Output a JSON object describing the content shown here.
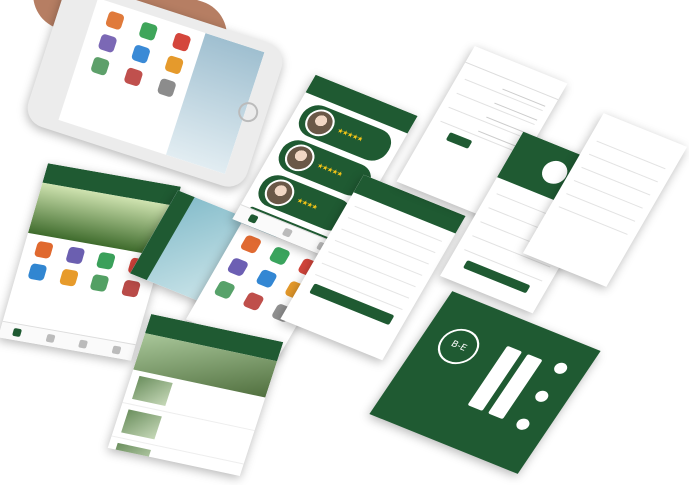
{
  "phone": {
    "banner_text": "",
    "menu_items": [
      "",
      "",
      "",
      "",
      "",
      "",
      "",
      "",
      "",
      "",
      "",
      ""
    ]
  },
  "home_screen": {
    "banner_text": "",
    "items": [
      "",
      "",
      "",
      "",
      "",
      "",
      "",
      "",
      "",
      "",
      "",
      ""
    ]
  },
  "expert_list": {
    "title": "",
    "ratings": [
      "★★★★★",
      "★★★★★",
      "★★★★"
    ],
    "submit_label": ""
  },
  "question_list": {
    "lines": [
      "",
      "",
      "",
      "",
      "",
      "",
      "",
      ""
    ],
    "button": ""
  },
  "form_screen": {
    "tabs": [
      "",
      ""
    ],
    "fields": [
      "",
      "",
      "",
      ""
    ],
    "button": ""
  },
  "profile_screen": {
    "rows": [
      "",
      "",
      "",
      "",
      ""
    ],
    "button": ""
  },
  "news_screen": {
    "items": [
      "",
      "",
      ""
    ]
  },
  "login_screen": {
    "logo": "B-E",
    "buttons": [
      "",
      ""
    ]
  },
  "colors": {
    "brand": "#1f5a32",
    "star": "#f5c518"
  }
}
